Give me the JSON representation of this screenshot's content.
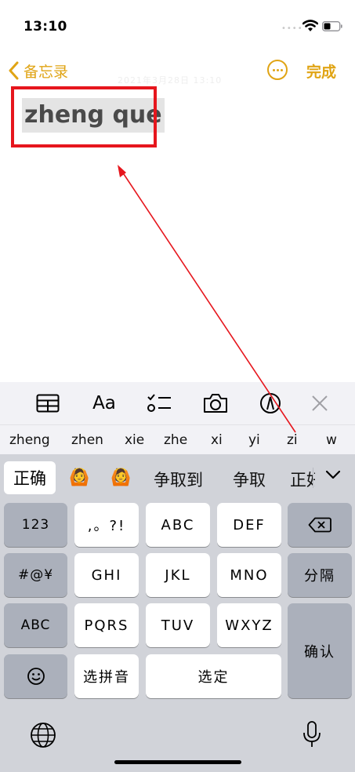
{
  "status_bar": {
    "time": "13:10",
    "signal_dots": "••••",
    "wifi_icon": "wifi-icon",
    "battery_icon": "battery-icon"
  },
  "nav": {
    "back_label": "备忘录",
    "more_icon": "ellipsis-circle-icon",
    "done_label": "完成",
    "accent_color": "#e0a414"
  },
  "note": {
    "text": "zheng que",
    "ghost_date": "2021年3月28日 13:10"
  },
  "annotation": {
    "box_color": "#e6161d"
  },
  "toolbar": {
    "icons": [
      "table-icon",
      "format-text-icon",
      "checklist-icon",
      "camera-icon",
      "markup-pen-icon",
      "close-icon"
    ],
    "format_label": "Aa"
  },
  "pinyin_suggestions": [
    "zheng",
    "zhen",
    "xie",
    "zhe",
    "xi",
    "yi",
    "zi",
    "w"
  ],
  "candidates": {
    "first": "正确",
    "items": [
      "🙆",
      "🙆",
      "争取到",
      "争取",
      "正好"
    ],
    "expand_icon": "chevron-down-icon"
  },
  "keyboard": {
    "left_col": [
      "123",
      "#@¥",
      "ABC"
    ],
    "row1": [
      ",。?!",
      "ABC",
      "DEF"
    ],
    "row2": [
      "GHI",
      "JKL",
      "MNO"
    ],
    "row3": [
      "PQRS",
      "TUV",
      "WXYZ"
    ],
    "backspace_icon": "backspace-icon",
    "separator_label": "分隔",
    "confirm_label": "确认",
    "emoji_icon": "emoji-icon",
    "select_pinyin_label": "选拼音",
    "select_label": "选定",
    "globe_icon": "globe-icon",
    "mic_icon": "microphone-icon"
  }
}
